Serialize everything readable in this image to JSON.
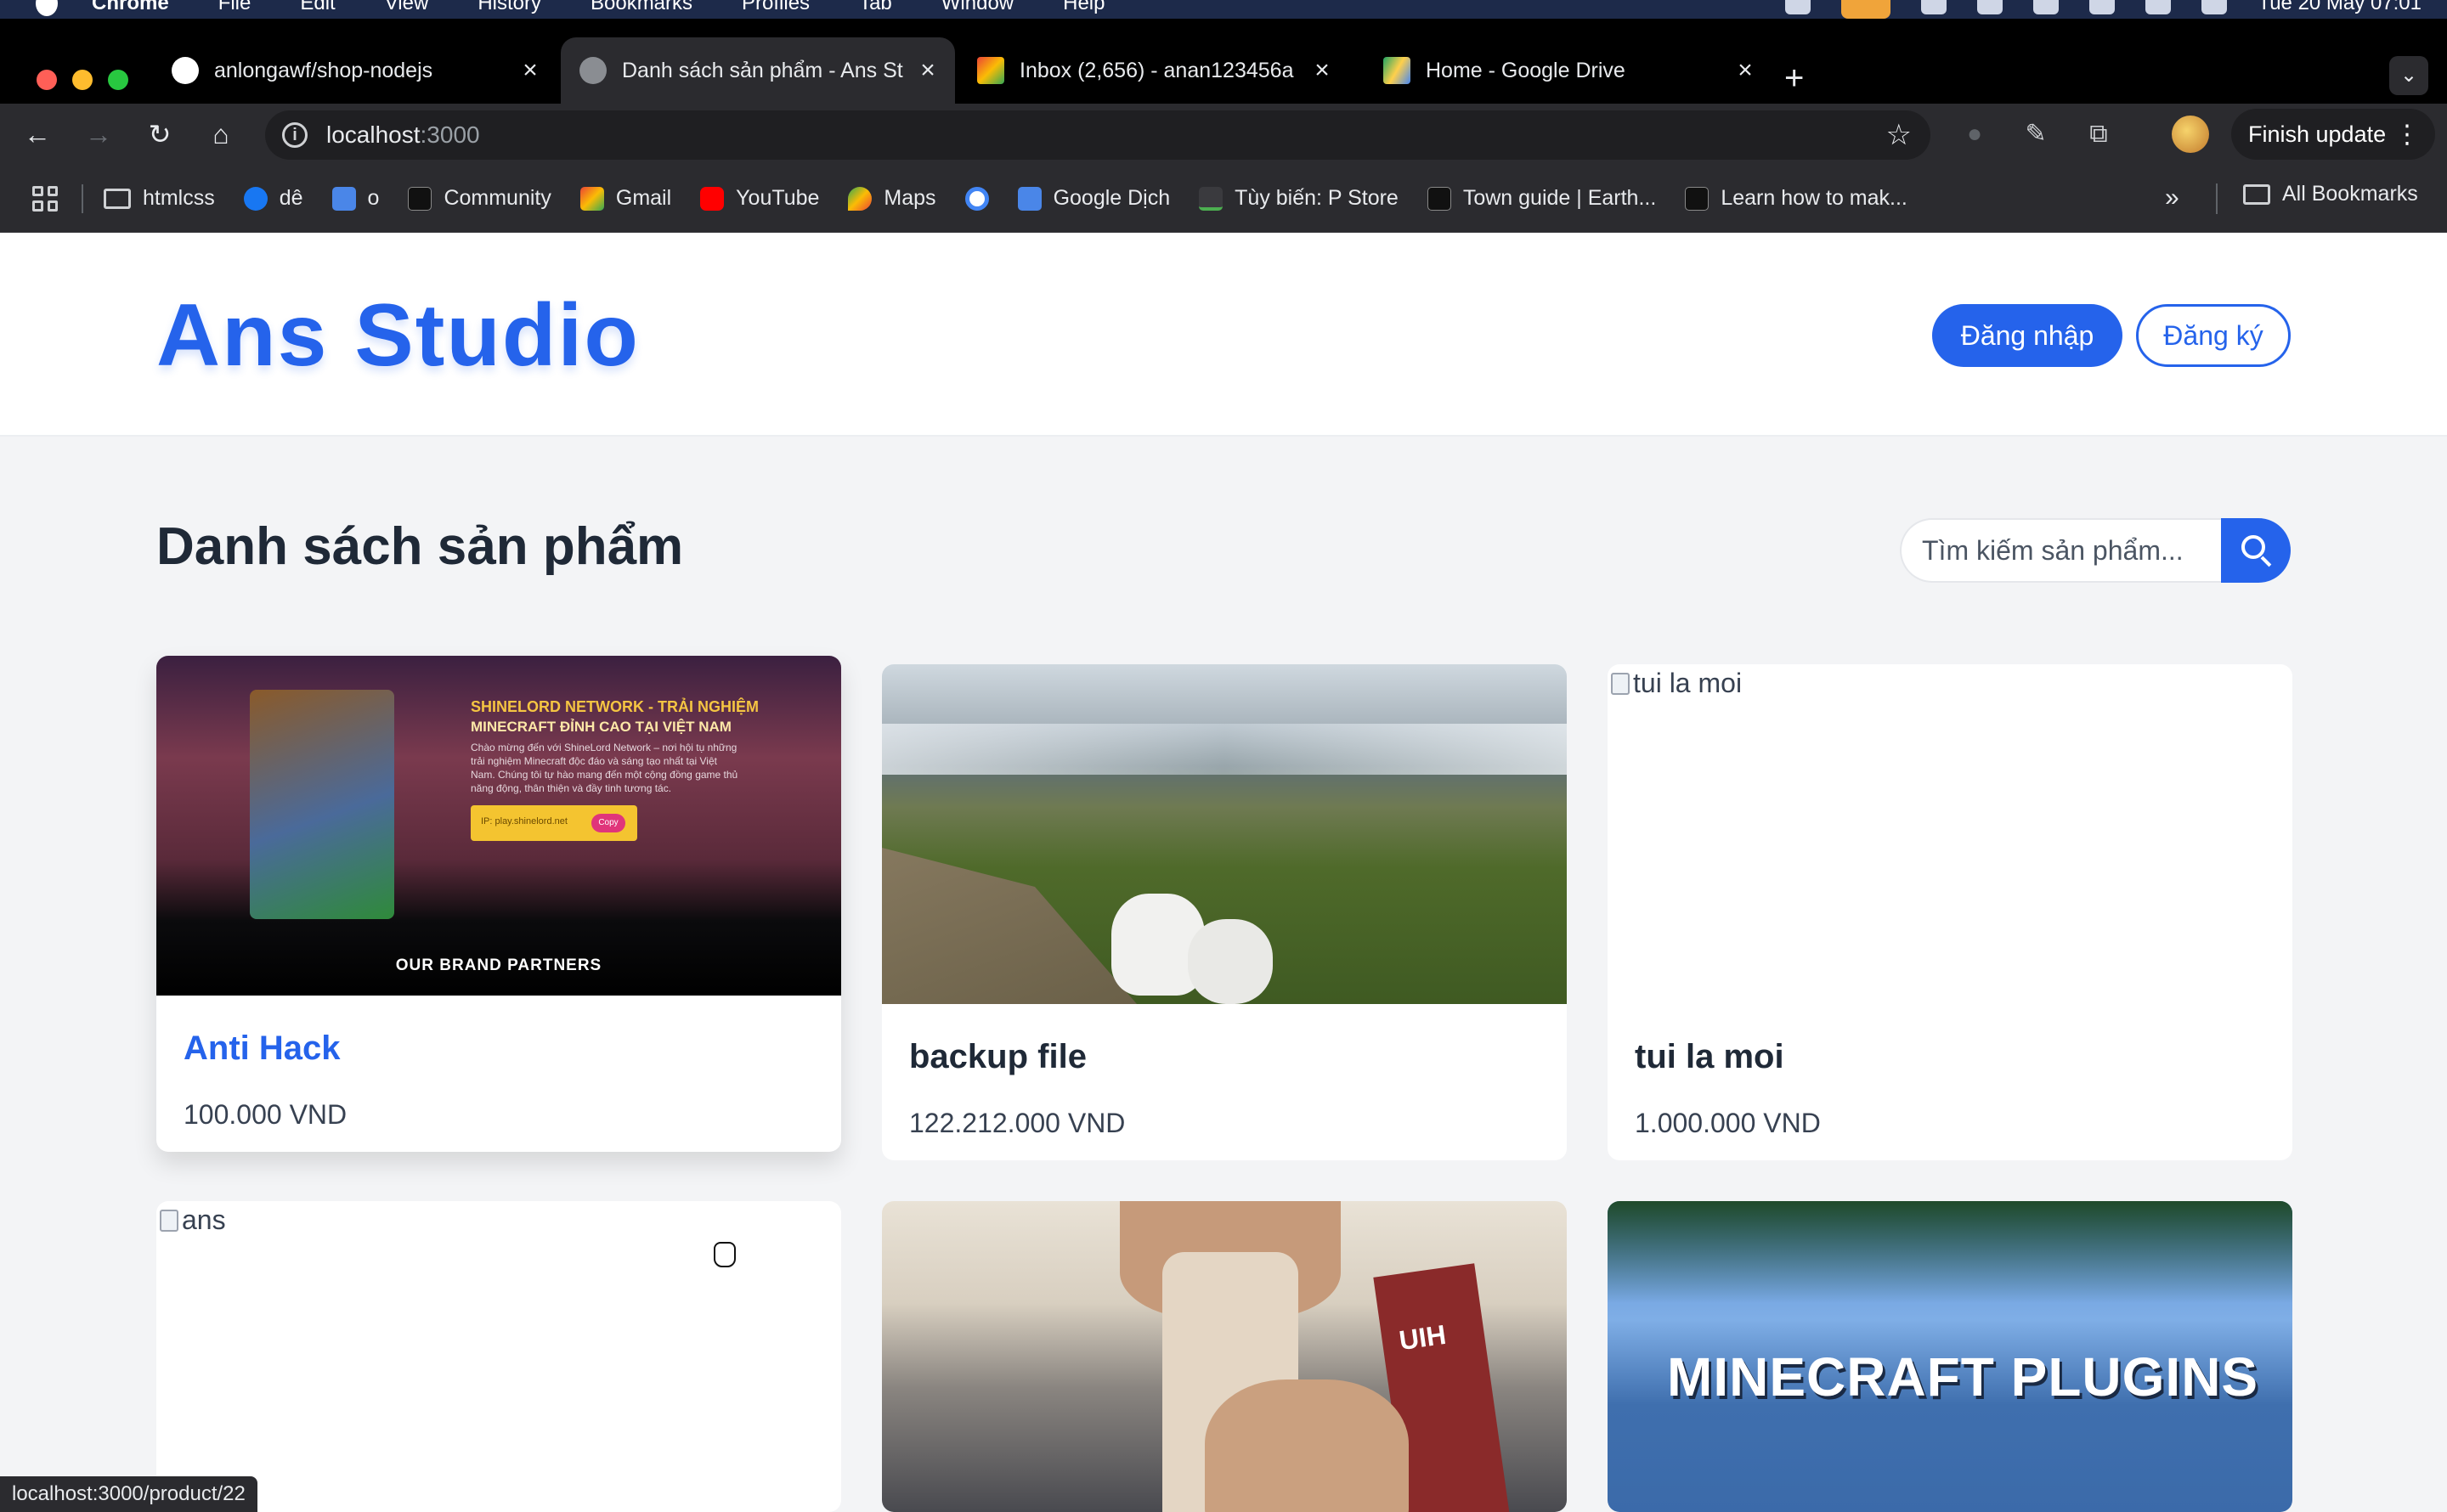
{
  "menubar": {
    "app": "Chrome",
    "menus": [
      "File",
      "Edit",
      "View",
      "History",
      "Bookmarks",
      "Profiles",
      "Tab",
      "Window",
      "Help"
    ],
    "clock": "Tue 20 May  07:01"
  },
  "tabs": [
    {
      "title": "anlongawf/shop-nodejs",
      "icon": "github-icon",
      "active": false
    },
    {
      "title": "Danh sách sản phẩm - Ans St",
      "icon": "globe-icon",
      "active": true
    },
    {
      "title": "Inbox (2,656) - anan123456a",
      "icon": "gmail-icon",
      "active": false
    },
    {
      "title": "Home - Google Drive",
      "icon": "google-drive-icon",
      "active": false
    }
  ],
  "toolbar": {
    "url_host": "localhost",
    "url_port": ":3000",
    "finish_update": "Finish update"
  },
  "bookmarks": [
    {
      "label": "htmlcss",
      "icon": "folder-icon"
    },
    {
      "label": "dê",
      "icon": "facebook-icon"
    },
    {
      "label": "o",
      "icon": "google-translate-icon"
    },
    {
      "label": "Community",
      "icon": "epic-icon"
    },
    {
      "label": "Gmail",
      "icon": "gmail-icon"
    },
    {
      "label": "YouTube",
      "icon": "youtube-icon"
    },
    {
      "label": "Maps",
      "icon": "maps-icon"
    },
    {
      "label": "",
      "icon": "google-icon"
    },
    {
      "label": "Google Dịch",
      "icon": "google-translate-icon"
    },
    {
      "label": "Tùy biến: P Store",
      "icon": "store-icon"
    },
    {
      "label": "Town guide | Earth...",
      "icon": "epic-icon"
    },
    {
      "label": "Learn how to mak...",
      "icon": "epic-icon"
    }
  ],
  "bookmarks_all": "All Bookmarks",
  "site": {
    "logo": "Ans Studio",
    "login": "Đăng nhập",
    "register": "Đăng ký",
    "page_title": "Danh sách sản phẩm",
    "search_placeholder": "Tìm kiếm sản phẩm..."
  },
  "products": [
    {
      "name": "Anti Hack",
      "price": "100.000 VND",
      "hovered": true,
      "image": {
        "hero_title": "SHINELORD NETWORK - TRẢI NGHIỆM",
        "hero_sub": "MINECRAFT ĐỈNH CAO TẠI VIỆT NAM",
        "hero_body": "Chào mừng đến với ShineLord Network – nơi hội tụ những trải nghiệm Minecraft độc đáo và sáng tạo nhất tại Việt Nam. Chúng tôi tự hào mang đến một cộng đồng game thủ năng động, thân thiện và đầy tinh tương tác.",
        "ip": "IP: play.shinelord.net",
        "copy": "Copy",
        "partners": "OUR BRAND PARTNERS"
      }
    },
    {
      "name": "backup file",
      "price": "122.212.000 VND"
    },
    {
      "name": "tui la moi",
      "price": "1.000.000 VND",
      "alt": "tui la moi"
    },
    {
      "name": "",
      "price": "",
      "alt": "ans"
    },
    {
      "name": "",
      "price": "",
      "image": {
        "strap_text": "UIH"
      }
    },
    {
      "name": "",
      "price": "",
      "image": {
        "overlay_text": "MINECRAFT PLUGINS"
      }
    }
  ],
  "status_url": "localhost:3000/product/22",
  "colors": {
    "brand": "#2563eb",
    "page_bg": "#f3f4f6",
    "text": "#1f2937"
  }
}
